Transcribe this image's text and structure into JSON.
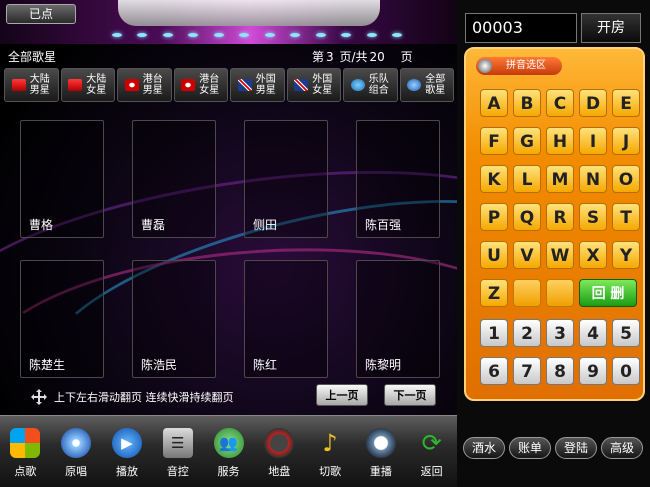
{
  "topbar": {
    "selected_label": "已点"
  },
  "header": {
    "all_singers": "全部歌星",
    "page_prefix": "第",
    "current_page": "3",
    "page_mid": "页/共",
    "total_pages": "20",
    "page_suffix": "页"
  },
  "categories": [
    {
      "line1": "大陆",
      "line2": "男星",
      "icon": "china-flag-icon",
      "color": "#d80000"
    },
    {
      "line1": "大陆",
      "line2": "女星",
      "icon": "china-flag-icon",
      "color": "#d80000"
    },
    {
      "line1": "港台",
      "line2": "男星",
      "icon": "hongkong-flag-icon",
      "color": "#d80000"
    },
    {
      "line1": "港台",
      "line2": "女星",
      "icon": "hongkong-flag-icon",
      "color": "#d80000"
    },
    {
      "line1": "外国",
      "line2": "男星",
      "icon": "uk-flag-icon",
      "color": "#1b3c8c"
    },
    {
      "line1": "外国",
      "line2": "女星",
      "icon": "uk-flag-icon",
      "color": "#1b3c8c"
    },
    {
      "line1": "乐队",
      "line2": "组合",
      "icon": "band-icon",
      "color": "#3aa0d8"
    },
    {
      "line1": "全部",
      "line2": "歌星",
      "icon": "globe-icon",
      "color": "#2a7bd0"
    }
  ],
  "singers": [
    "曹格",
    "曹磊",
    "侧田",
    "陈百强",
    "陈楚生",
    "陈浩民",
    "陈红",
    "陈黎明"
  ],
  "hint": "上下左右滑动翻页   连续快滑持续翻页",
  "prev_page": "上一页",
  "next_page": "下一页",
  "bottom_bar": [
    {
      "label": "点歌",
      "icon": "windows-logo-icon",
      "color": "#3a78d8"
    },
    {
      "label": "原唱",
      "icon": "music-disc-icon",
      "color": "#8ec8ff"
    },
    {
      "label": "播放",
      "icon": "play-icon",
      "color": "#1a78e0"
    },
    {
      "label": "音控",
      "icon": "mixer-icon",
      "color": "#9c9c9c"
    },
    {
      "label": "服务",
      "icon": "users-icon",
      "color": "#4caf50"
    },
    {
      "label": "地盘",
      "icon": "speedometer-icon",
      "color": "#c02020"
    },
    {
      "label": "切歌",
      "icon": "music-note-icon",
      "color": "#f0c020"
    },
    {
      "label": "重播",
      "icon": "clock-icon",
      "color": "#6a8aa8"
    },
    {
      "label": "返回",
      "icon": "refresh-icon",
      "color": "#2eb82e"
    }
  ],
  "room": {
    "number": "00003",
    "open_label": "开房"
  },
  "keypad": {
    "tab_label": "拼音选区",
    "letters": [
      "A",
      "B",
      "C",
      "D",
      "E",
      "F",
      "G",
      "H",
      "I",
      "J",
      "K",
      "L",
      "M",
      "N",
      "O",
      "P",
      "Q",
      "R",
      "S",
      "T",
      "U",
      "V",
      "W",
      "X",
      "Y",
      "Z"
    ],
    "delete_label": "回 删",
    "digits": [
      "1",
      "2",
      "3",
      "4",
      "5",
      "6",
      "7",
      "8",
      "9",
      "0"
    ]
  },
  "right_buttons": [
    "酒水",
    "账单",
    "登陆",
    "高级"
  ]
}
